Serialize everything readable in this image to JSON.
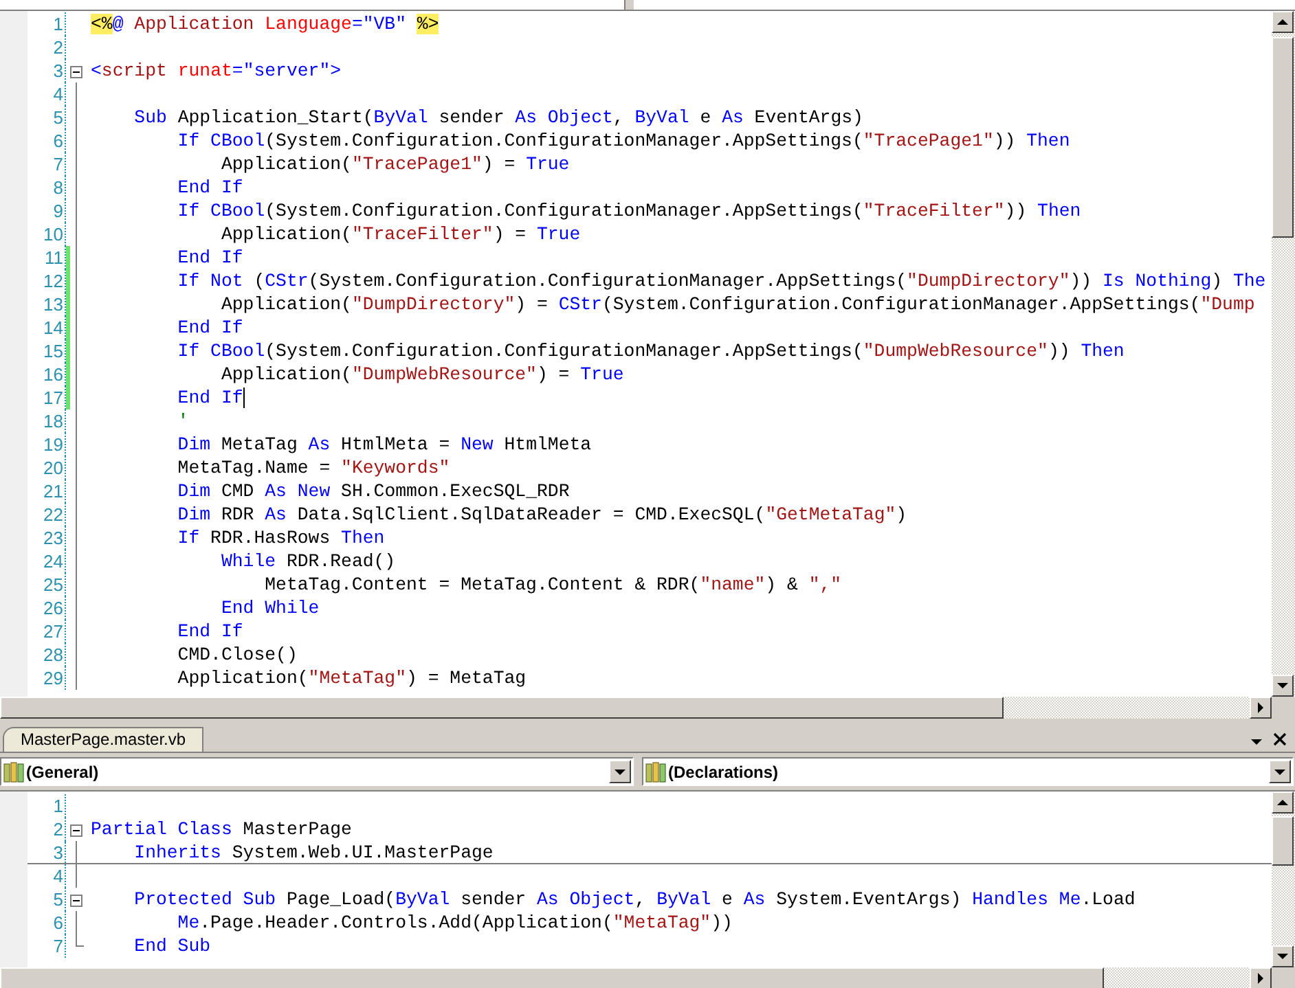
{
  "top_editor": {
    "lines": [
      {
        "number": "1",
        "kind": "plain",
        "changed": false,
        "cursor": false,
        "tokens": [
          {
            "kind": "delim",
            "text": "<%"
          },
          {
            "kind": "kw",
            "text": "@ "
          },
          {
            "kind": "elem",
            "text": "Application "
          },
          {
            "kind": "attr",
            "text": "Language"
          },
          {
            "kind": "kw",
            "text": "=\"VB\" "
          },
          {
            "kind": "delim",
            "text": "%>"
          }
        ]
      },
      {
        "number": "2",
        "kind": "plain",
        "changed": false,
        "cursor": false
      },
      {
        "number": "3",
        "kind": "start",
        "changed": false,
        "cursor": false,
        "tokens": [
          {
            "kind": "kw",
            "text": "<"
          },
          {
            "kind": "elem",
            "text": "script "
          },
          {
            "kind": "attr",
            "text": "runat"
          },
          {
            "kind": "kw",
            "text": "=\"server\">"
          }
        ]
      },
      {
        "number": "4",
        "kind": "body",
        "changed": false,
        "cursor": false
      },
      {
        "number": "5",
        "kind": "body",
        "changed": false,
        "cursor": false,
        "tokens": [
          {
            "kind": "kw",
            "text": "    Sub"
          },
          {
            "kind": "text",
            "text": " Application_Start("
          },
          {
            "kind": "kw",
            "text": "ByVal"
          },
          {
            "kind": "text",
            "text": " sender "
          },
          {
            "kind": "kw",
            "text": "As Object"
          },
          {
            "kind": "text",
            "text": ", "
          },
          {
            "kind": "kw",
            "text": "ByVal"
          },
          {
            "kind": "text",
            "text": " e "
          },
          {
            "kind": "kw",
            "text": "As"
          },
          {
            "kind": "text",
            "text": " EventArgs)"
          }
        ]
      },
      {
        "number": "6",
        "kind": "body",
        "changed": false,
        "cursor": false,
        "tokens": [
          {
            "kind": "kw",
            "text": "        If CBool"
          },
          {
            "kind": "text",
            "text": "(System.Configuration.ConfigurationManager.AppSettings("
          },
          {
            "kind": "str",
            "text": "\"TracePage1\""
          },
          {
            "kind": "text",
            "text": ")) "
          },
          {
            "kind": "kw",
            "text": "Then"
          }
        ]
      },
      {
        "number": "7",
        "kind": "body",
        "changed": false,
        "cursor": false,
        "tokens": [
          {
            "kind": "text",
            "text": "            Application("
          },
          {
            "kind": "str",
            "text": "\"TracePage1\""
          },
          {
            "kind": "text",
            "text": ") = "
          },
          {
            "kind": "kw",
            "text": "True"
          }
        ]
      },
      {
        "number": "8",
        "kind": "body",
        "changed": false,
        "cursor": false,
        "tokens": [
          {
            "kind": "kw",
            "text": "        End If"
          }
        ]
      },
      {
        "number": "9",
        "kind": "body",
        "changed": false,
        "cursor": false,
        "tokens": [
          {
            "kind": "kw",
            "text": "        If CBool"
          },
          {
            "kind": "text",
            "text": "(System.Configuration.ConfigurationManager.AppSettings("
          },
          {
            "kind": "str",
            "text": "\"TraceFilter\""
          },
          {
            "kind": "text",
            "text": ")) "
          },
          {
            "kind": "kw",
            "text": "Then"
          }
        ]
      },
      {
        "number": "10",
        "kind": "body",
        "changed": false,
        "cursor": false,
        "tokens": [
          {
            "kind": "text",
            "text": "            Application("
          },
          {
            "kind": "str",
            "text": "\"TraceFilter\""
          },
          {
            "kind": "text",
            "text": ") = "
          },
          {
            "kind": "kw",
            "text": "True"
          }
        ]
      },
      {
        "number": "11",
        "kind": "body",
        "changed": true,
        "cursor": false,
        "tokens": [
          {
            "kind": "kw",
            "text": "        End If"
          }
        ]
      },
      {
        "number": "12",
        "kind": "body",
        "changed": true,
        "cursor": false,
        "tokens": [
          {
            "kind": "kw",
            "text": "        If Not"
          },
          {
            "kind": "text",
            "text": " ("
          },
          {
            "kind": "kw",
            "text": "CStr"
          },
          {
            "kind": "text",
            "text": "(System.Configuration.ConfigurationManager.AppSettings("
          },
          {
            "kind": "str",
            "text": "\"DumpDirectory\""
          },
          {
            "kind": "text",
            "text": ")) "
          },
          {
            "kind": "kw",
            "text": "Is Nothing"
          },
          {
            "kind": "text",
            "text": ") "
          },
          {
            "kind": "kw",
            "text": "The"
          }
        ]
      },
      {
        "number": "13",
        "kind": "body",
        "changed": true,
        "cursor": false,
        "tokens": [
          {
            "kind": "text",
            "text": "            Application("
          },
          {
            "kind": "str",
            "text": "\"DumpDirectory\""
          },
          {
            "kind": "text",
            "text": ") = "
          },
          {
            "kind": "kw",
            "text": "CStr"
          },
          {
            "kind": "text",
            "text": "(System.Configuration.ConfigurationManager.AppSettings("
          },
          {
            "kind": "str",
            "text": "\"Dump"
          }
        ]
      },
      {
        "number": "14",
        "kind": "body",
        "changed": true,
        "cursor": false,
        "tokens": [
          {
            "kind": "kw",
            "text": "        End If"
          }
        ]
      },
      {
        "number": "15",
        "kind": "body",
        "changed": true,
        "cursor": false,
        "tokens": [
          {
            "kind": "kw",
            "text": "        If CBool"
          },
          {
            "kind": "text",
            "text": "(System.Configuration.ConfigurationManager.AppSettings("
          },
          {
            "kind": "str",
            "text": "\"DumpWebResource\""
          },
          {
            "kind": "text",
            "text": ")) "
          },
          {
            "kind": "kw",
            "text": "Then"
          }
        ]
      },
      {
        "number": "16",
        "kind": "body",
        "changed": true,
        "cursor": false,
        "tokens": [
          {
            "kind": "text",
            "text": "            Application("
          },
          {
            "kind": "str",
            "text": "\"DumpWebResource\""
          },
          {
            "kind": "text",
            "text": ") = "
          },
          {
            "kind": "kw",
            "text": "True"
          }
        ]
      },
      {
        "number": "17",
        "kind": "body",
        "changed": true,
        "cursor": true,
        "tokens": [
          {
            "kind": "kw",
            "text": "        End If"
          }
        ]
      },
      {
        "number": "18",
        "kind": "body",
        "changed": false,
        "cursor": false,
        "tokens": [
          {
            "kind": "comment",
            "text": "        '"
          }
        ]
      },
      {
        "number": "19",
        "kind": "body",
        "changed": false,
        "cursor": false,
        "tokens": [
          {
            "kind": "kw",
            "text": "        Dim"
          },
          {
            "kind": "text",
            "text": " MetaTag "
          },
          {
            "kind": "kw",
            "text": "As"
          },
          {
            "kind": "text",
            "text": " HtmlMeta = "
          },
          {
            "kind": "kw",
            "text": "New"
          },
          {
            "kind": "text",
            "text": " HtmlMeta"
          }
        ]
      },
      {
        "number": "20",
        "kind": "body",
        "changed": false,
        "cursor": false,
        "tokens": [
          {
            "kind": "text",
            "text": "        MetaTag.Name = "
          },
          {
            "kind": "str",
            "text": "\"Keywords\""
          }
        ]
      },
      {
        "number": "21",
        "kind": "body",
        "changed": false,
        "cursor": false,
        "tokens": [
          {
            "kind": "kw",
            "text": "        Dim"
          },
          {
            "kind": "text",
            "text": " CMD "
          },
          {
            "kind": "kw",
            "text": "As New"
          },
          {
            "kind": "text",
            "text": " SH.Common.ExecSQL_RDR"
          }
        ]
      },
      {
        "number": "22",
        "kind": "body",
        "changed": false,
        "cursor": false,
        "tokens": [
          {
            "kind": "kw",
            "text": "        Dim"
          },
          {
            "kind": "text",
            "text": " RDR "
          },
          {
            "kind": "kw",
            "text": "As"
          },
          {
            "kind": "text",
            "text": " Data.SqlClient.SqlDataReader = CMD.ExecSQL("
          },
          {
            "kind": "str",
            "text": "\"GetMetaTag\""
          },
          {
            "kind": "text",
            "text": ")"
          }
        ]
      },
      {
        "number": "23",
        "kind": "body",
        "changed": false,
        "cursor": false,
        "tokens": [
          {
            "kind": "kw",
            "text": "        If"
          },
          {
            "kind": "text",
            "text": " RDR.HasRows "
          },
          {
            "kind": "kw",
            "text": "Then"
          }
        ]
      },
      {
        "number": "24",
        "kind": "body",
        "changed": false,
        "cursor": false,
        "tokens": [
          {
            "kind": "kw",
            "text": "            While"
          },
          {
            "kind": "text",
            "text": " RDR.Read()"
          }
        ]
      },
      {
        "number": "25",
        "kind": "body",
        "changed": false,
        "cursor": false,
        "tokens": [
          {
            "kind": "text",
            "text": "                MetaTag.Content = MetaTag.Content & RDR("
          },
          {
            "kind": "str",
            "text": "\"name\""
          },
          {
            "kind": "text",
            "text": ") & "
          },
          {
            "kind": "str",
            "text": "\",\""
          }
        ]
      },
      {
        "number": "26",
        "kind": "body",
        "changed": false,
        "cursor": false,
        "tokens": [
          {
            "kind": "kw",
            "text": "            End While"
          }
        ]
      },
      {
        "number": "27",
        "kind": "body",
        "changed": false,
        "cursor": false,
        "tokens": [
          {
            "kind": "kw",
            "text": "        End If"
          }
        ]
      },
      {
        "number": "28",
        "kind": "body",
        "changed": false,
        "cursor": false,
        "tokens": [
          {
            "kind": "text",
            "text": "        CMD.Close()"
          }
        ]
      },
      {
        "number": "29",
        "kind": "body",
        "changed": false,
        "cursor": false,
        "tokens": [
          {
            "kind": "text",
            "text": "        Application("
          },
          {
            "kind": "str",
            "text": "\"MetaTag\""
          },
          {
            "kind": "text",
            "text": ") = MetaTag"
          }
        ]
      }
    ]
  },
  "bottom_editor": {
    "tab": {
      "label": "MasterPage.master.vb",
      "selected": true
    },
    "object_combo": {
      "value": "(General)"
    },
    "member_combo": {
      "value": "(Declarations)"
    },
    "lines": [
      {
        "number": "1",
        "kind": "plain",
        "changed": false,
        "cursor": false,
        "separator": false
      },
      {
        "number": "2",
        "kind": "start",
        "changed": false,
        "cursor": false,
        "separator": false,
        "tokens": [
          {
            "kind": "kw",
            "text": "Partial Class"
          },
          {
            "kind": "text",
            "text": " MasterPage"
          }
        ]
      },
      {
        "number": "3",
        "kind": "body",
        "changed": false,
        "cursor": false,
        "separator": true,
        "tokens": [
          {
            "kind": "kw",
            "text": "    Inherits"
          },
          {
            "kind": "text",
            "text": " System.Web.UI.MasterPage"
          }
        ]
      },
      {
        "number": "4",
        "kind": "body",
        "changed": false,
        "cursor": false,
        "separator": false
      },
      {
        "number": "5",
        "kind": "start",
        "changed": false,
        "cursor": false,
        "separator": false,
        "tokens": [
          {
            "kind": "kw",
            "text": "    Protected Sub"
          },
          {
            "kind": "text",
            "text": " Page_Load("
          },
          {
            "kind": "kw",
            "text": "ByVal"
          },
          {
            "kind": "text",
            "text": " sender "
          },
          {
            "kind": "kw",
            "text": "As Object"
          },
          {
            "kind": "text",
            "text": ", "
          },
          {
            "kind": "kw",
            "text": "ByVal"
          },
          {
            "kind": "text",
            "text": " e "
          },
          {
            "kind": "kw",
            "text": "As"
          },
          {
            "kind": "text",
            "text": " System.EventArgs) "
          },
          {
            "kind": "kw",
            "text": "Handles Me"
          },
          {
            "kind": "text",
            "text": ".Load"
          }
        ]
      },
      {
        "number": "6",
        "kind": "body",
        "changed": false,
        "cursor": false,
        "separator": false,
        "tokens": [
          {
            "kind": "kw",
            "text": "        Me"
          },
          {
            "kind": "text",
            "text": ".Page.Header.Controls.Add(Application("
          },
          {
            "kind": "str",
            "text": "\"MetaTag\""
          },
          {
            "kind": "text",
            "text": "))"
          }
        ]
      },
      {
        "number": "7",
        "kind": "end",
        "changed": false,
        "cursor": false,
        "separator": false,
        "tokens": [
          {
            "kind": "kw",
            "text": "    End Sub"
          }
        ]
      }
    ]
  }
}
